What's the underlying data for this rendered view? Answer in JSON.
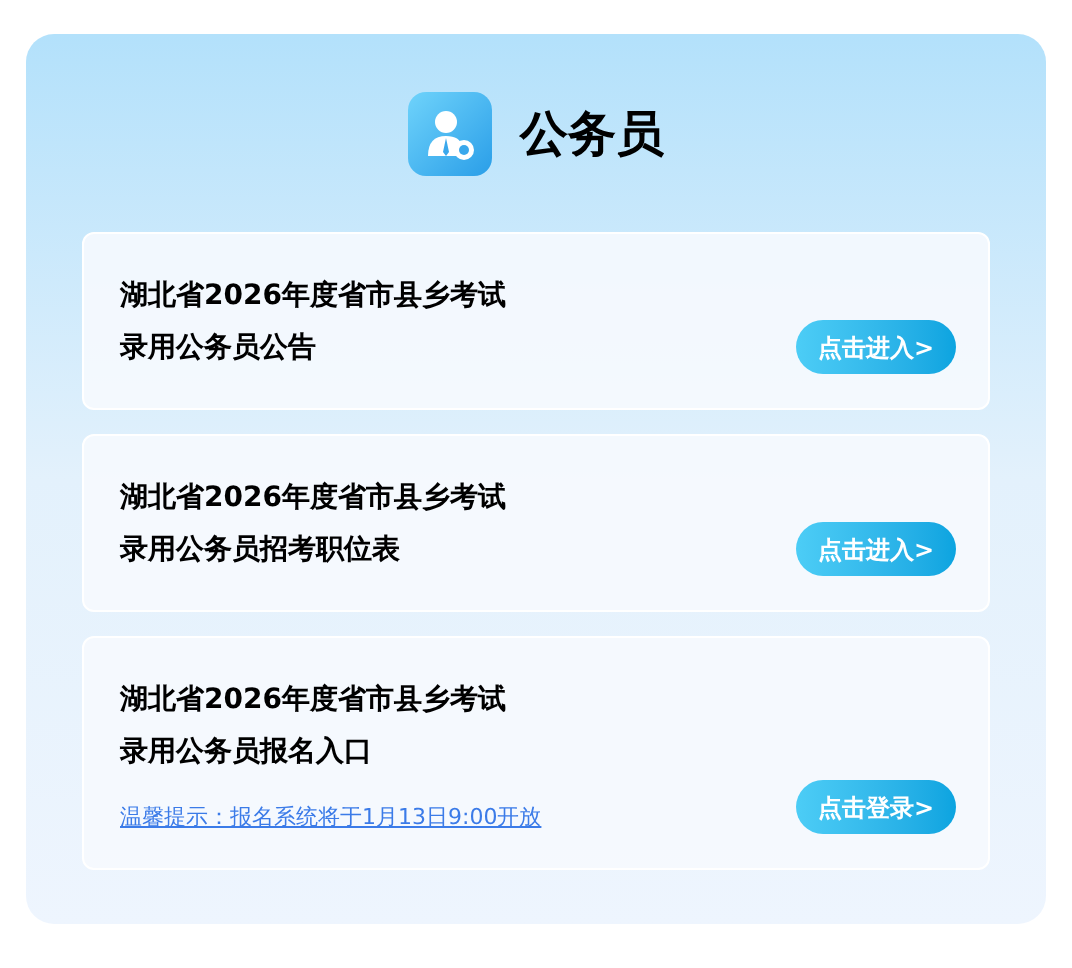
{
  "header": {
    "title": "公务员"
  },
  "cards": [
    {
      "title_lines": [
        "湖北省2026年度省市县乡考试",
        "录用公务员公告"
      ],
      "button": "点击进入>"
    },
    {
      "title_lines": [
        "湖北省2026年度省市县乡考试",
        "录用公务员招考职位表"
      ],
      "button": "点击进入>"
    },
    {
      "title_lines": [
        "湖北省2026年度省市县乡考试",
        "录用公务员报名入口"
      ],
      "notice": "温馨提示：报名系统将于1月13日9:00开放",
      "button": "点击登录>"
    }
  ]
}
